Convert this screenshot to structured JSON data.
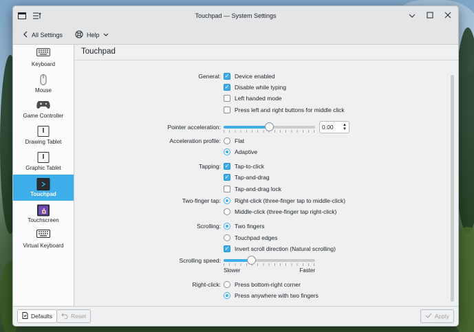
{
  "window": {
    "title": "Touchpad — System Settings"
  },
  "toolbar": {
    "back_label": "All Settings",
    "help_label": "Help"
  },
  "sidebar": {
    "items": [
      {
        "label": "Keyboard",
        "icon": "keyboard-icon"
      },
      {
        "label": "Mouse",
        "icon": "mouse-icon"
      },
      {
        "label": "Game Controller",
        "icon": "gamepad-icon"
      },
      {
        "label": "Drawing Tablet",
        "icon": "tablet-icon"
      },
      {
        "label": "Graphic Tablet",
        "icon": "tablet-icon"
      },
      {
        "label": "Touchpad",
        "icon": "touchpad-icon",
        "active": true
      },
      {
        "label": "Touchscreen",
        "icon": "touchscreen-icon"
      },
      {
        "label": "Virtual Keyboard",
        "icon": "keyboard-icon"
      }
    ]
  },
  "page": {
    "title": "Touchpad"
  },
  "general": {
    "label": "General:",
    "options": [
      {
        "label": "Device enabled",
        "checked": true
      },
      {
        "label": "Disable while typing",
        "checked": true
      },
      {
        "label": "Left handed mode",
        "checked": false
      },
      {
        "label": "Press left and right buttons for middle click",
        "checked": false
      }
    ]
  },
  "pointer": {
    "label": "Pointer acceleration:",
    "value": "0.00",
    "level": 0.5
  },
  "accel_profile": {
    "label": "Acceleration profile:",
    "options": [
      {
        "label": "Flat",
        "selected": false
      },
      {
        "label": "Adaptive",
        "selected": true
      }
    ]
  },
  "tapping": {
    "label": "Tapping:",
    "options": [
      {
        "label": "Tap-to-click",
        "checked": true
      },
      {
        "label": "Tap-and-drag",
        "checked": true
      },
      {
        "label": "Tap-and-drag lock",
        "checked": false
      }
    ]
  },
  "two_finger": {
    "label": "Two-finger tap:",
    "options": [
      {
        "label": "Right-click (three-finger tap to middle-click)",
        "selected": true
      },
      {
        "label": "Middle-click (three-finger tap right-click)",
        "selected": false
      }
    ]
  },
  "scrolling": {
    "label": "Scrolling:",
    "options": [
      {
        "label": "Two fingers",
        "selected": true
      },
      {
        "label": "Touchpad edges",
        "selected": false
      }
    ],
    "invert_label": "Invert scroll direction (Natural scrolling)",
    "invert_checked": true
  },
  "scroll_speed": {
    "label": "Scrolling speed:",
    "slower": "Slower",
    "faster": "Faster",
    "level": 0.3
  },
  "right_click": {
    "label": "Right-click:",
    "options": [
      {
        "label": "Press bottom-right corner",
        "selected": false
      },
      {
        "label": "Press anywhere with two fingers",
        "selected": true
      }
    ]
  },
  "footer": {
    "defaults_label": "Defaults",
    "reset_label": "Reset",
    "apply_label": "Apply"
  },
  "colors": {
    "accent": "#3daee9"
  }
}
